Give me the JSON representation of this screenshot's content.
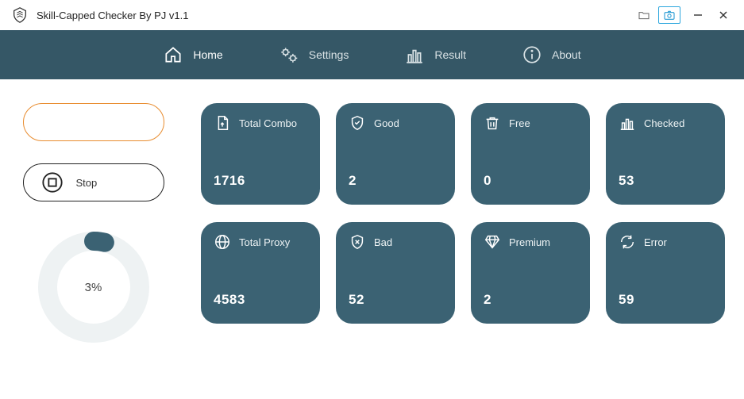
{
  "title": "Skill-Capped Checker By PJ v1.1",
  "nav": {
    "home": "Home",
    "settings": "Settings",
    "result": "Result",
    "about": "About"
  },
  "controls": {
    "start_label": "",
    "stop_label": "Stop"
  },
  "progress": {
    "percent": 3,
    "label": "3%"
  },
  "stats": {
    "total_combo": {
      "label": "Total Combo",
      "value": "1716"
    },
    "good": {
      "label": "Good",
      "value": "2"
    },
    "free": {
      "label": "Free",
      "value": "0"
    },
    "checked": {
      "label": "Checked",
      "value": "53"
    },
    "total_proxy": {
      "label": "Total Proxy",
      "value": "4583"
    },
    "bad": {
      "label": "Bad",
      "value": "52"
    },
    "premium": {
      "label": "Premium",
      "value": "2"
    },
    "error": {
      "label": "Error",
      "value": "59"
    }
  },
  "colors": {
    "brand": "#355766",
    "card": "#3b6273",
    "accent_orange": "#e88c2f",
    "ring_track": "#eef2f3"
  }
}
